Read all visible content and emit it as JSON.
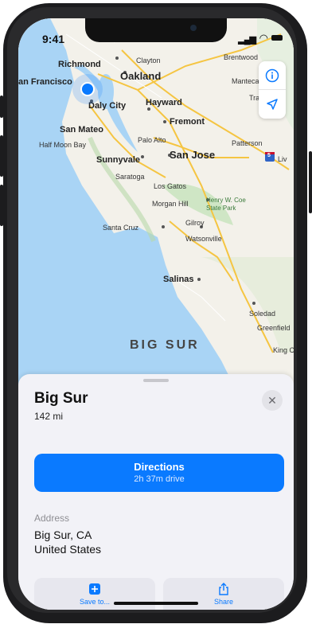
{
  "status_bar": {
    "time": "9:41"
  },
  "map": {
    "labels": {
      "richmond": "Richmond",
      "clayton": "Clayton",
      "brentwood": "Brentwood",
      "san_francisco": "an Francisco",
      "oakland": "Oakland",
      "manteca": "Manteca",
      "daly_city": "Daly City",
      "hayward": "Hayward",
      "tracy": "Tracy",
      "fremont": "Fremont",
      "san_mateo": "San Mateo",
      "half_moon_bay": "Half Moon Bay",
      "palo_alto": "Palo Alto",
      "san_jose": "San Jose",
      "patterson": "Patterson",
      "sunnyvale": "Sunnyvale",
      "saratoga": "Saratoga",
      "los_gatos": "Los Gatos",
      "morgan_hill": "Morgan Hill",
      "henry_coe": "Henry W. Coe State Park",
      "santa_cruz": "Santa Cruz",
      "gilroy": "Gilroy",
      "watsonville": "Watsonville",
      "salinas": "Salinas",
      "soledad": "Soledad",
      "greenfield": "Greenfield",
      "king_city": "King C",
      "livingston": "Liv",
      "region": "BIG SUR"
    },
    "highway_shield": "5"
  },
  "place": {
    "name": "Big Sur",
    "distance": "142 mi",
    "directions_label": "Directions",
    "directions_sub": "2h 37m drive",
    "address_caption": "Address",
    "address_line1": "Big Sur, CA",
    "address_line2": "United States"
  },
  "actions": {
    "save_label": "Save to...",
    "share_label": "Share"
  },
  "colors": {
    "accent": "#0a7aff",
    "water": "#a9d4f5",
    "land": "#f3f1ea",
    "park": "#cfe6c5",
    "road": "#f5c542"
  }
}
